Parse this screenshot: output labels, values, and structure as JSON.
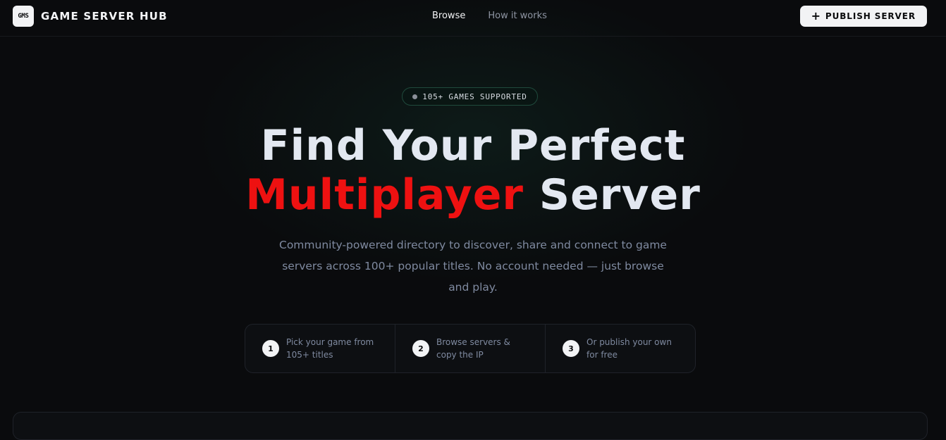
{
  "header": {
    "logo_text": "GMS",
    "brand_name": "GAME SERVER HUB",
    "nav": [
      {
        "label": "Browse",
        "active": true
      },
      {
        "label": "How it works",
        "active": false
      }
    ],
    "publish_label": "PUBLISH SERVER",
    "publish_icon": "plus-icon"
  },
  "hero": {
    "badge": "105+ GAMES SUPPORTED",
    "headline_line1": "Find Your Perfect",
    "headline_accent": "Multiplayer",
    "headline_rest": "Server",
    "subtitle": "Community-powered directory to discover, share and connect to game servers across 100+ popular titles. No account needed — just browse and play."
  },
  "steps": [
    {
      "number": "1",
      "text": "Pick your game from 105+ titles"
    },
    {
      "number": "2",
      "text": "Browse servers & copy the IP"
    },
    {
      "number": "3",
      "text": "Or publish your own for free"
    }
  ],
  "colors": {
    "accent": "#ee1111",
    "background": "#0a0b0d",
    "badge_border": "#1f4a3c"
  }
}
